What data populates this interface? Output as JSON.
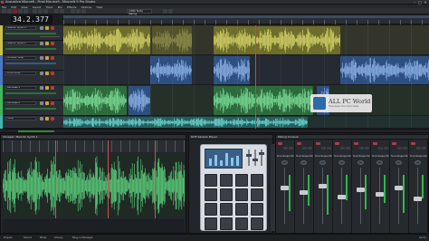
{
  "window": {
    "title": "Acoustica Mixcraft - Final Mix.mx9 - Mixcraft 9 Pro Studio",
    "minimize": "–",
    "maximize": "□",
    "close": "×"
  },
  "menu": [
    "File",
    "Edit",
    "View",
    "Sound",
    "Track",
    "Mix",
    "Effects",
    "Options",
    "Help"
  ],
  "toolbar": {
    "snap_select": "1/8th Note Swing"
  },
  "transport": {
    "time": "34.2.377",
    "small_time": "00:0"
  },
  "tracks": [
    {
      "name": "Melodic Synth 1",
      "color": "#c8c24a"
    },
    {
      "name": "Melodic Synth 2",
      "color": "#c8c24a"
    },
    {
      "name": "Acoustic Loop",
      "color": "#4a77c8"
    },
    {
      "name": "Drum Loop",
      "color": "#4a77c8"
    },
    {
      "name": "Pad Bass 1",
      "color": "#3fb85a"
    },
    {
      "name": "Pad Bass 2",
      "color": "#3fb85a"
    },
    {
      "name": "Vocal",
      "color": "#3fb8b0"
    }
  ],
  "watermark": {
    "text": "ALL PC World",
    "sub": "Free Apps One Click Away"
  },
  "chopper": {
    "title": "Chopper: Melodic Synth 1"
  },
  "pad_device": {
    "title": "Drift Sample Player"
  },
  "mixer": {
    "title": "Mixing Console",
    "strips": [
      {
        "name": "Soundscape Pad 1"
      },
      {
        "name": "Soundscape Pad 2"
      },
      {
        "name": "Soundscape Pad 3"
      },
      {
        "name": "Soundscape Pad 4"
      },
      {
        "name": "Soundscape Pad 5"
      },
      {
        "name": "Soundscape Pad 6"
      },
      {
        "name": "Soundscape Pad 7"
      },
      {
        "name": "Soundscape Pad 8"
      }
    ]
  },
  "bottom": {
    "tabs": [
      "Project",
      "Sound",
      "Mixer",
      "Library",
      "Plug-in Manager"
    ],
    "status": "Ready"
  }
}
